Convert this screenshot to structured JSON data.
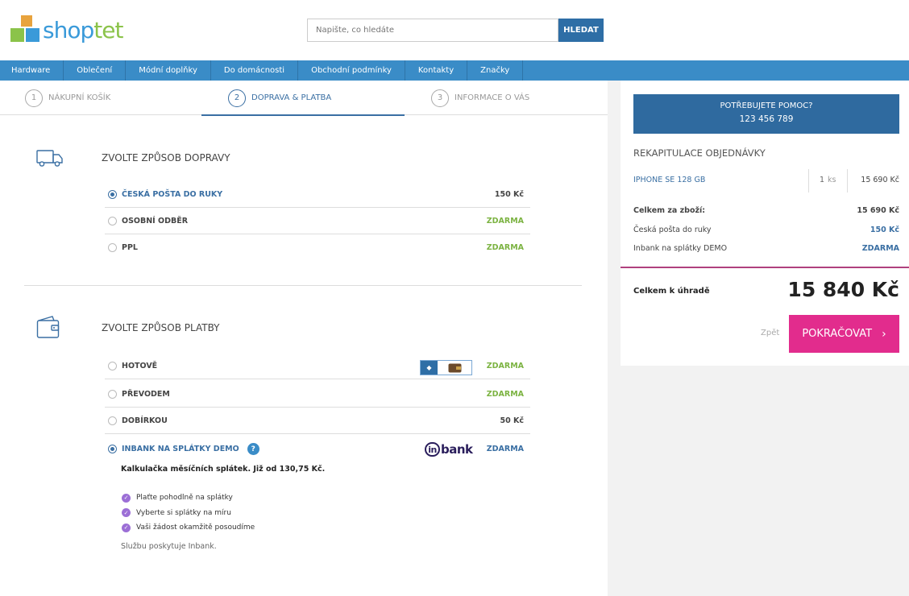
{
  "header": {
    "logo_part1": "shop",
    "logo_part2": "tet",
    "search_placeholder": "Napište, co hledáte",
    "search_button": "HLEDAT"
  },
  "nav": [
    "Hardware",
    "Oblečení",
    "Módní doplňky",
    "Do domácnosti",
    "Obchodní podmínky",
    "Kontakty",
    "Značky"
  ],
  "steps": [
    {
      "num": "1",
      "label": "NÁKUPNÍ KOŠÍK"
    },
    {
      "num": "2",
      "label": "DOPRAVA & PLATBA"
    },
    {
      "num": "3",
      "label": "INFORMACE O VÁS"
    }
  ],
  "shipping": {
    "title": "ZVOLTE ZPŮSOB DOPRAVY",
    "options": [
      {
        "label": "ČESKÁ POŠTA DO RUKY",
        "price": "150 Kč",
        "selected": true
      },
      {
        "label": "OSOBNÍ ODBĚR",
        "price": "ZDARMA"
      },
      {
        "label": "PPL",
        "price": "ZDARMA"
      }
    ]
  },
  "payment": {
    "title": "ZVOLTE ZPŮSOB PLATBY",
    "options": [
      {
        "label": "HOTOVĚ",
        "price": "ZDARMA"
      },
      {
        "label": "PŘEVODEM",
        "price": "ZDARMA"
      },
      {
        "label": "DOBÍRKOU",
        "price": "50 Kč"
      },
      {
        "label": "INBANK NA SPLÁTKY DEMO",
        "price": "ZDARMA",
        "selected": true
      }
    ],
    "help_glyph": "?",
    "inbank_logo_in": "in",
    "inbank_logo_rest": "bank",
    "calculator": "Kalkulačka měsíčních splátek. Již od 130,75 Kč.",
    "bullets": [
      "Plaťte pohodlně na splátky",
      "Vyberte si splátky na míru",
      "Vaši žádost okamžitě posoudíme"
    ],
    "provider": "Službu poskytuje Inbank."
  },
  "sidebar": {
    "help_title": "POTŘEBUJETE POMOC?",
    "help_phone": "123 456 789",
    "recap_title": "REKAPITULACE OBJEDNÁVKY",
    "item": {
      "name": "IPHONE SE 128 GB",
      "qty": "1",
      "unit": "ks",
      "price": "15 690 Kč"
    },
    "goods_label": "Celkem za zboží:",
    "goods_value": "15 690 Kč",
    "shipping_label": "Česká pošta do ruky",
    "shipping_value": "150 Kč",
    "payment_label": "Inbank na splátky DEMO",
    "payment_value": "ZDARMA",
    "total_label": "Celkem k úhradě",
    "total_value": "15 840 Kč",
    "back": "Zpět",
    "continue": "POKRAČOVAT"
  },
  "colors": {
    "brand_blue": "#3a8cc7",
    "dark_blue": "#2f6a9f",
    "free_green": "#7cb342",
    "cta_pink": "#e22c8d"
  }
}
